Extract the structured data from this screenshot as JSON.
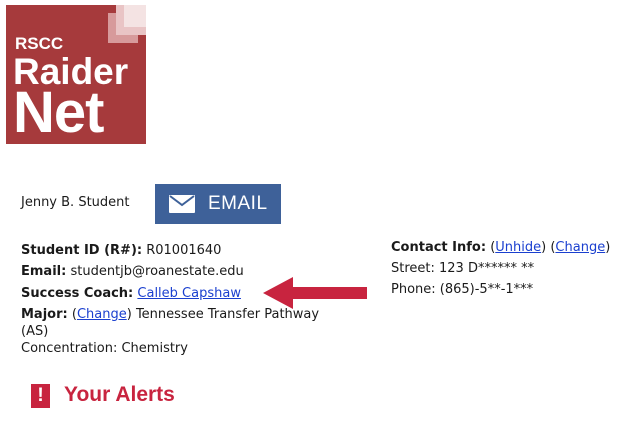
{
  "logo": {
    "line1": "RSCC",
    "line2": "Raider",
    "line3": "Net",
    "color": "#a63a3c"
  },
  "student": {
    "name": "Jenny B. Student"
  },
  "email_button": {
    "icon": "envelope-icon",
    "label": "EMAIL",
    "color": "#3e6199"
  },
  "details": {
    "student_id_label": "Student ID (R#):",
    "student_id": "R01001640",
    "email_label": "Email:",
    "email": "studentjb@roanestate.edu",
    "coach_label": "Success Coach:",
    "coach": "Calleb Capshaw",
    "major_label": "Major:",
    "change_label": "Change",
    "major_line1": "Tennessee Transfer Pathway",
    "major_line2": "(AS)",
    "concentration": "Concentration: Chemistry"
  },
  "contact": {
    "label": "Contact Info:",
    "unhide_label": "Unhide",
    "change_label": "Change",
    "street": "Street: 123 D****** **",
    "phone": "Phone: (865)-5**-1***"
  },
  "annotation": {
    "arrow_color": "#c8243f"
  },
  "alerts": {
    "icon": "exclamation-icon",
    "icon_glyph": "!",
    "title": "Your Alerts",
    "color": "#c8243f"
  }
}
